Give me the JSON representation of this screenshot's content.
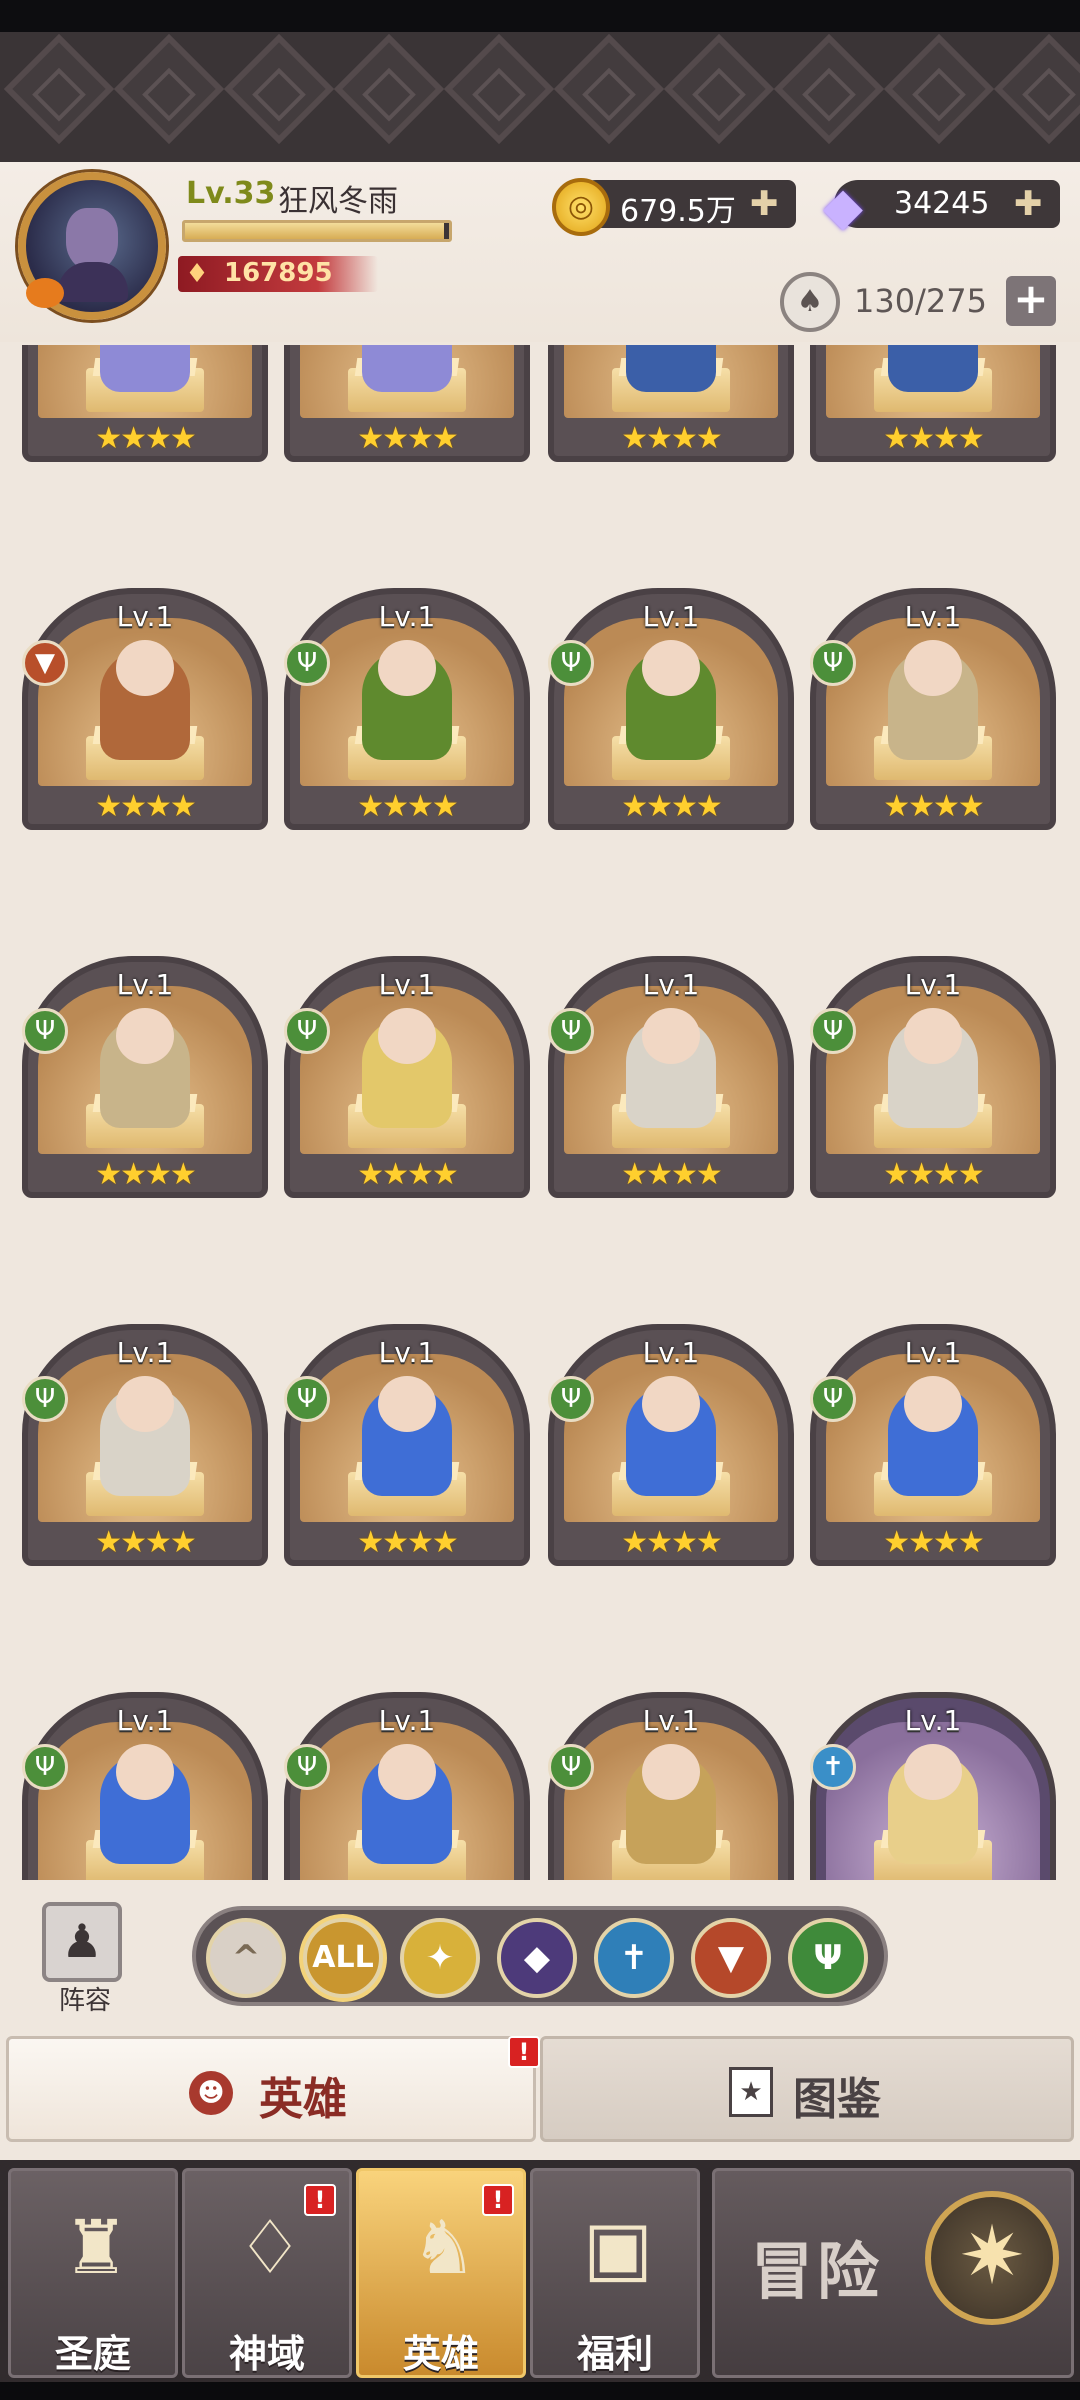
{
  "player": {
    "level": "Lv.33",
    "name": "狂风冬雨",
    "power": "167895",
    "xp_progress": 0.98
  },
  "resources": {
    "gold": "679.5万",
    "diamonds": "34245",
    "capacity": "130/275"
  },
  "icons": {
    "plus": "plus-icon",
    "coin": "gold-coin-icon",
    "gem": "diamond-icon",
    "capacity": "hero-capacity-icon"
  },
  "heroes": [
    {
      "level": "",
      "class": "",
      "stars": 4
    },
    {
      "level": "",
      "class": "",
      "stars": 4
    },
    {
      "level": "",
      "class": "",
      "stars": 4
    },
    {
      "level": "",
      "class": "",
      "stars": 4
    },
    {
      "level": "Lv.1",
      "class": "beast",
      "stars": 4
    },
    {
      "level": "Lv.1",
      "class": "nature",
      "stars": 4
    },
    {
      "level": "Lv.1",
      "class": "nature",
      "stars": 4
    },
    {
      "level": "Lv.1",
      "class": "nature",
      "stars": 4
    },
    {
      "level": "Lv.1",
      "class": "nature",
      "stars": 4
    },
    {
      "level": "Lv.1",
      "class": "nature",
      "stars": 4
    },
    {
      "level": "Lv.1",
      "class": "nature",
      "stars": 4
    },
    {
      "level": "Lv.1",
      "class": "nature",
      "stars": 4
    },
    {
      "level": "Lv.1",
      "class": "nature",
      "stars": 4
    },
    {
      "level": "Lv.1",
      "class": "nature",
      "stars": 4
    },
    {
      "level": "Lv.1",
      "class": "nature",
      "stars": 4
    },
    {
      "level": "Lv.1",
      "class": "nature",
      "stars": 4
    },
    {
      "level": "Lv.1",
      "class": "nature",
      "stars": 4
    },
    {
      "level": "Lv.1",
      "class": "nature",
      "stars": 4
    },
    {
      "level": "Lv.1",
      "class": "nature",
      "stars": 4
    },
    {
      "level": "Lv.1",
      "class": "holy",
      "stars": 4
    }
  ],
  "lineup": {
    "label": "阵容"
  },
  "filters": [
    {
      "id": "sort",
      "label": "^",
      "color": "#d9d0c6"
    },
    {
      "id": "all",
      "label": "ALL",
      "color": "#c9962f"
    },
    {
      "id": "light",
      "label": "✦",
      "color": "#d8b13a"
    },
    {
      "id": "dark",
      "label": "◆",
      "color": "#4d3a7a"
    },
    {
      "id": "holy",
      "label": "✝",
      "color": "#2f7fb8"
    },
    {
      "id": "beast",
      "label": "▼",
      "color": "#b5482a"
    },
    {
      "id": "nature",
      "label": "Ψ",
      "color": "#3f8a3a"
    }
  ],
  "tabs": {
    "heroes": "英雄",
    "codex": "图鉴",
    "alert": "!"
  },
  "nav": [
    {
      "label": "圣庭",
      "icon": "castle-icon",
      "alert": false,
      "active": false
    },
    {
      "label": "神域",
      "icon": "crystal-shrine-icon",
      "alert": true,
      "active": false
    },
    {
      "label": "英雄",
      "icon": "helmet-icon",
      "alert": true,
      "active": true
    },
    {
      "label": "福利",
      "icon": "treasure-chest-icon",
      "alert": false,
      "active": false
    }
  ],
  "adventure": {
    "label": "冒险",
    "icon": "compass-icon"
  },
  "colors": {
    "accent": "#c9913e",
    "alert": "#d82222",
    "star": "#ffcf2e"
  }
}
